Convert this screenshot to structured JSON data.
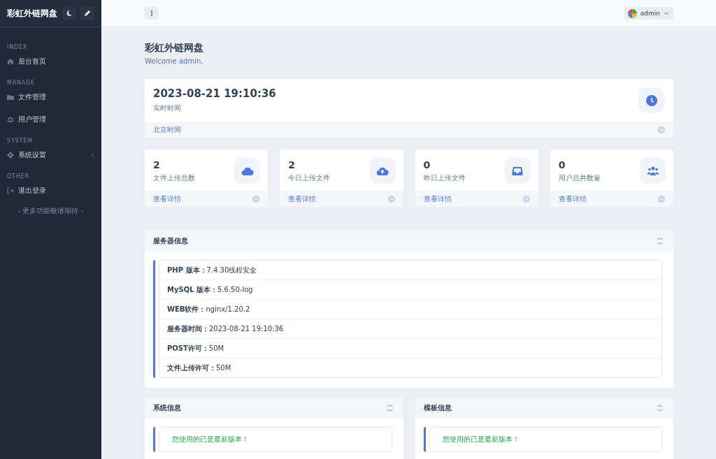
{
  "sidebar": {
    "brand": "彩虹外链网盘",
    "sections": [
      {
        "heading": "INDEX",
        "items": [
          {
            "label": "后台首页",
            "kind": "home",
            "expandable": false
          }
        ]
      },
      {
        "heading": "MANAGE",
        "items": [
          {
            "label": "文件管理",
            "kind": "folder",
            "expandable": false
          },
          {
            "label": "用户管理",
            "kind": "users",
            "expandable": false
          }
        ]
      },
      {
        "heading": "SYSTEM",
        "items": [
          {
            "label": "系统设置",
            "kind": "gear",
            "expandable": true
          }
        ]
      },
      {
        "heading": "OTHER",
        "items": [
          {
            "label": "退出登录",
            "kind": "logout",
            "expandable": false
          }
        ]
      }
    ],
    "footer": "- 更多功能敬请期待 -"
  },
  "header": {
    "user": "admin"
  },
  "page": {
    "title": "彩虹外链网盘",
    "welcome": "Welcome",
    "welcome_user": "admin,"
  },
  "clock": {
    "time": "2023-08-21 19:10:36",
    "label": "实时时间",
    "footer": "北京时间"
  },
  "stats": [
    {
      "value": "2",
      "label": "文件上传总数",
      "kind": "cloud",
      "link": "查看详情"
    },
    {
      "value": "2",
      "label": "今日上传文件",
      "kind": "upload",
      "link": "查看详情"
    },
    {
      "value": "0",
      "label": "昨日上传文件",
      "kind": "inbox",
      "link": "查看详情"
    },
    {
      "value": "0",
      "label": "用户总共数量",
      "kind": "users",
      "link": "查看详情"
    }
  ],
  "server": {
    "title": "服务器信息",
    "rows": [
      {
        "label": "PHP 版本：",
        "value": "7.4.30线程安全"
      },
      {
        "label": "MySQL 版本：",
        "value": "5.6.50-log"
      },
      {
        "label": "WEB软件：",
        "value": "nginx/1.20.2"
      },
      {
        "label": "服务器时间：",
        "value": "2023-08-21 19:10:36"
      },
      {
        "label": "POST许可：",
        "value": "50M"
      },
      {
        "label": "文件上传许可：",
        "value": "50M"
      }
    ]
  },
  "panels": [
    {
      "title": "系统信息",
      "message": "您使用的已是最新版本！"
    },
    {
      "title": "模板信息",
      "message": "您使用的已是最新版本！"
    }
  ]
}
